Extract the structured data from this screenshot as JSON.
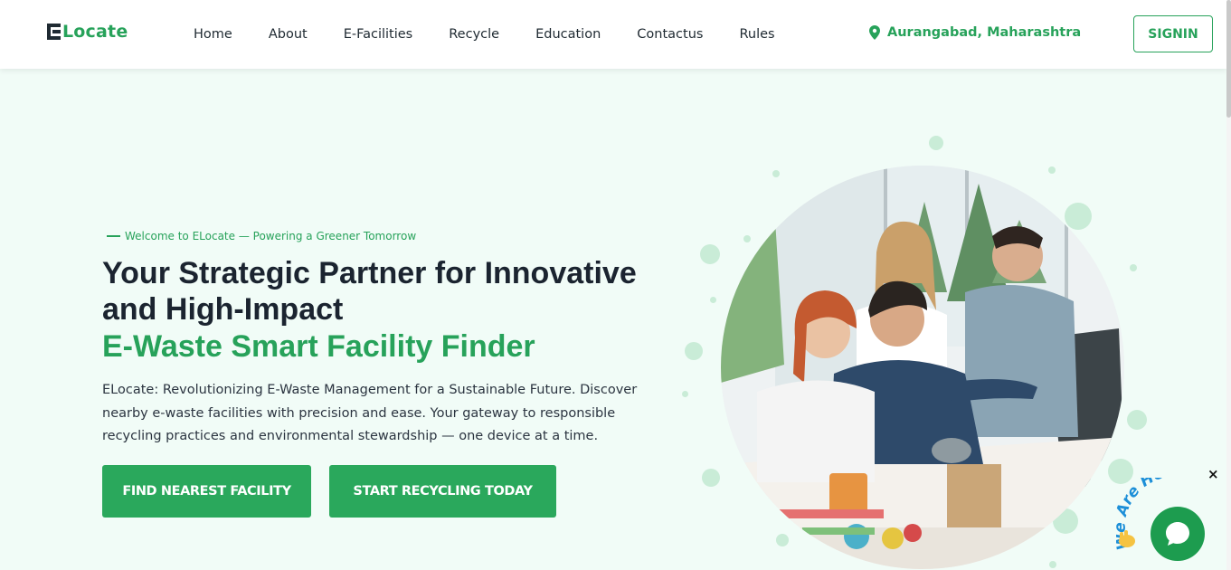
{
  "header": {
    "logo_text": "Locate",
    "nav": [
      "Home",
      "About",
      "E-Facilities",
      "Recycle",
      "Education",
      "Contactus",
      "Rules"
    ],
    "location": "Aurangabad, Maharashtra",
    "signin_label": "SIGNIN"
  },
  "hero": {
    "tagline": "Welcome to ELocate — Powering a Greener Tomorrow",
    "headline": "Your Strategic Partner for Innovative and High-Impact",
    "headline_green": "E-Waste Smart Facility Finder",
    "description": "ELocate: Revolutionizing E-Waste Management for a Sustainable Future. Discover nearby e-waste facilities with precision and ease. Your gateway to responsible recycling practices and environmental stewardship — one device at a time.",
    "primary_button": "FIND NEAREST FACILITY",
    "secondary_button": "START RECYCLING TODAY"
  },
  "chat": {
    "close_label": "×",
    "badge_text": "We Are Here!"
  },
  "colors": {
    "brand_green": "#27a25a",
    "hero_background": "#f1fcf7",
    "text_dark": "#1b2430"
  },
  "icons": {
    "location": "map-pin-icon",
    "chat": "chat-bubble-icon",
    "close": "close-icon",
    "wave": "waving-hand-icon"
  }
}
